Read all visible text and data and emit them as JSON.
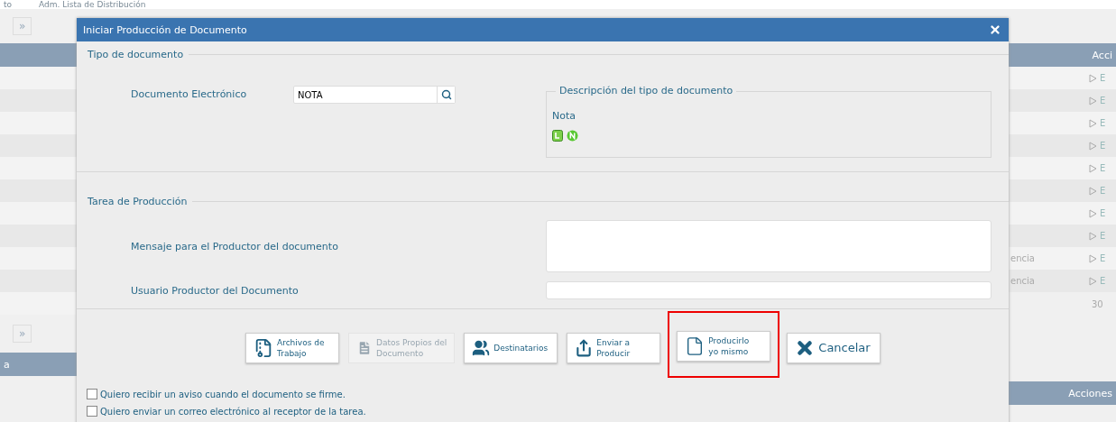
{
  "background": {
    "top_links": [
      "to",
      "Adm. Lista de Distribución"
    ],
    "left": {
      "pager": "»",
      "bottom_pager": "»",
      "bottom_header": "a"
    },
    "right": {
      "header": "Acci",
      "rows": [
        {
          "text": "",
          "action": "E"
        },
        {
          "text": "",
          "action": "E"
        },
        {
          "text": "",
          "action": "E"
        },
        {
          "text": "",
          "action": "E"
        },
        {
          "text": "",
          "action": "E"
        },
        {
          "text": "",
          "action": "E"
        },
        {
          "text": "",
          "action": "E"
        },
        {
          "text": "",
          "action": "E"
        },
        {
          "text": "encia",
          "action": "E"
        },
        {
          "text": "encia",
          "action": "E"
        }
      ],
      "count": "30",
      "bottom_header": "Acciones"
    }
  },
  "dialog": {
    "title": "Iniciar Producción de Documento",
    "tipo": {
      "legend": "Tipo de documento",
      "label": "Documento Electrónico",
      "value": "NOTA",
      "description": {
        "legend": "Descripción del tipo de documento",
        "text": "Nota"
      }
    },
    "tarea": {
      "legend": "Tarea de Producción",
      "fields": [
        {
          "kind": "textarea",
          "label": "Mensaje para el Productor del documento"
        },
        {
          "kind": "input",
          "label": "Usuario Productor del Documento"
        }
      ]
    },
    "buttons": [
      {
        "kind": "archive",
        "lines": [
          "Archivos de",
          "Trabajo"
        ],
        "disabled": false,
        "highlighted": false
      },
      {
        "kind": "text",
        "lines": [
          "Datos Propios del",
          "Documento"
        ],
        "disabled": true,
        "highlighted": false
      },
      {
        "kind": "people",
        "lines": [
          "Destinatarios"
        ],
        "disabled": false,
        "highlighted": false
      },
      {
        "kind": "send",
        "lines": [
          "Enviar a",
          "Producir"
        ],
        "disabled": false,
        "highlighted": false
      },
      {
        "kind": "file",
        "lines": [
          "Producirlo",
          "yo mismo"
        ],
        "disabled": false,
        "highlighted": true
      },
      {
        "kind": "cancel",
        "lines": [
          "Cancelar"
        ],
        "disabled": false,
        "highlighted": false
      }
    ],
    "checkboxes": [
      {
        "label": "Quiero recibir un aviso cuando el documento se firme.",
        "checked": false
      },
      {
        "label": "Quiero enviar un correo electrónico al receptor de la tarea.",
        "checked": false
      }
    ]
  }
}
